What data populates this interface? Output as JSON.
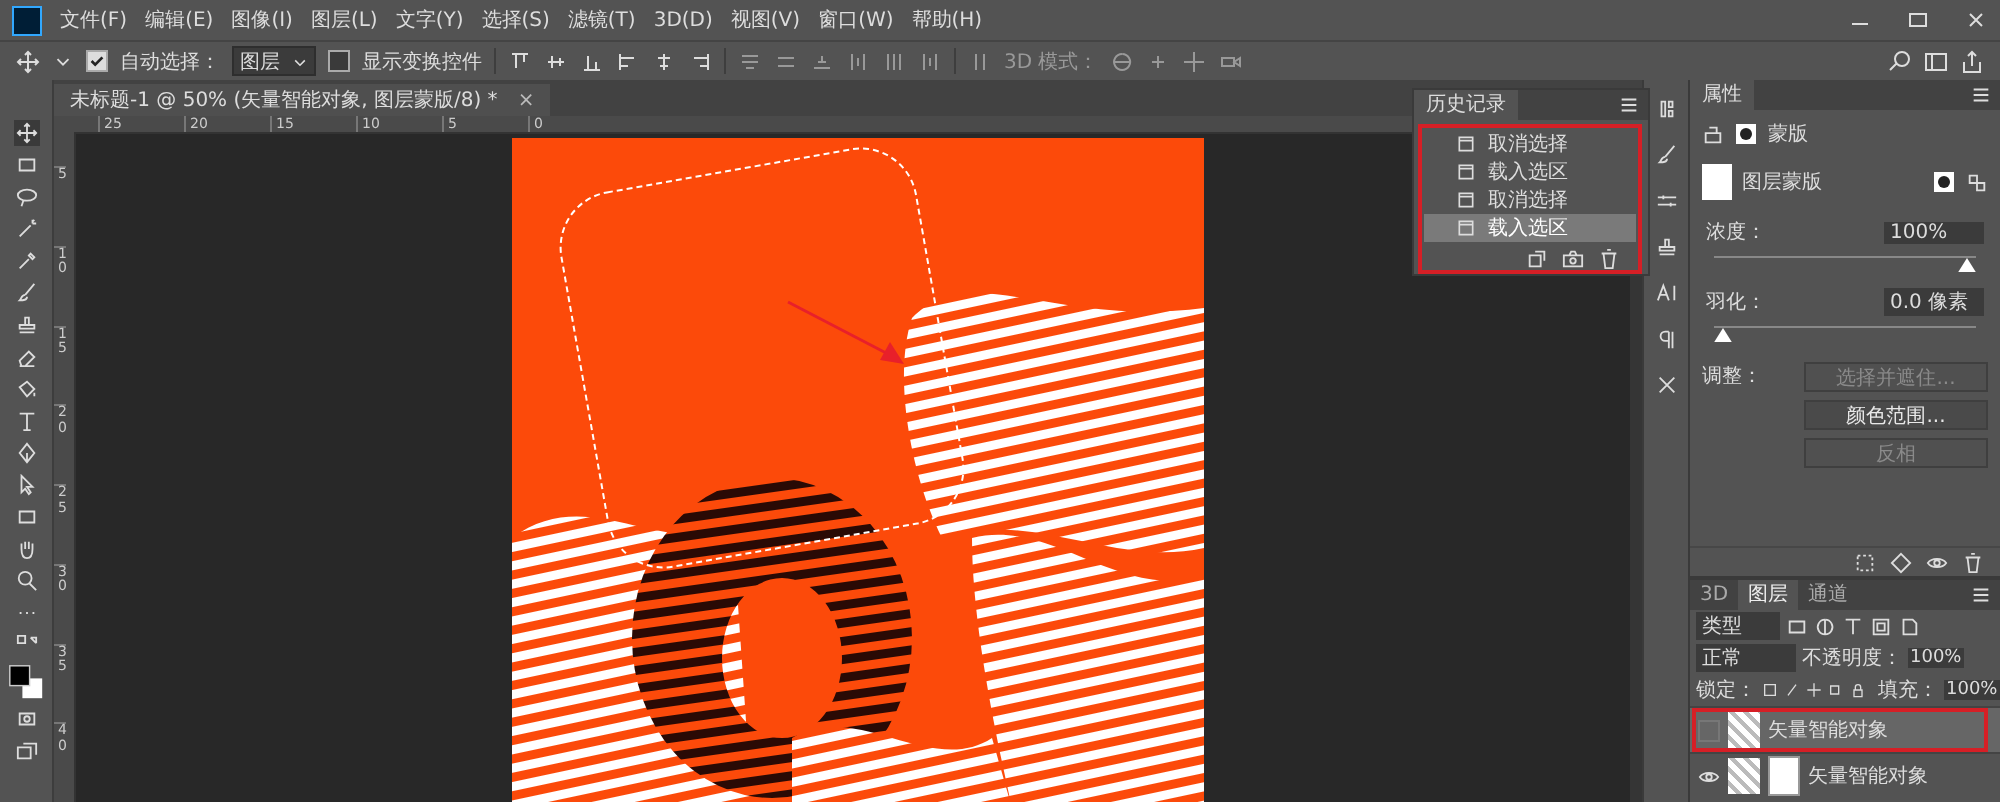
{
  "menu_bar": {
    "items": [
      "文件(F)",
      "编辑(E)",
      "图像(I)",
      "图层(L)",
      "文字(Y)",
      "选择(S)",
      "滤镜(T)",
      "3D(D)",
      "视图(V)",
      "窗口(W)",
      "帮助(H)"
    ]
  },
  "options_bar": {
    "auto_select": {
      "label": "自动选择：",
      "checked": true
    },
    "auto_select_target": "图层",
    "show_transform_controls": {
      "label": "显示变换控件",
      "checked": false
    },
    "mode_3d_label": "3D 模式："
  },
  "document_tab": {
    "title": "未标题-1 @ 50% (矢量智能对象, 图层蒙版/8) *",
    "close": "×"
  },
  "rulers": {
    "top_labels": [
      "25",
      "20",
      "15",
      "10",
      "5",
      "0"
    ],
    "left_labels": [
      "5",
      "10",
      "15",
      "20",
      "25",
      "30",
      "35",
      "40"
    ]
  },
  "history_panel": {
    "title": "历史记录",
    "items": [
      {
        "label": "取消选择",
        "selected": false
      },
      {
        "label": "载入选区",
        "selected": false
      },
      {
        "label": "取消选择",
        "selected": false
      },
      {
        "label": "载入选区",
        "selected": true
      }
    ]
  },
  "properties_panel": {
    "title": "属性",
    "section": "蒙版",
    "mask_type": "图层蒙版",
    "density": {
      "label": "浓度：",
      "value": "100%",
      "level": 1
    },
    "feather": {
      "label": "羽化：",
      "value": "0.0 像素",
      "level": 0
    },
    "adjust_label": "调整：",
    "buttons": [
      {
        "label": "选择并遮住...",
        "disabled": true
      },
      {
        "label": "颜色范围...",
        "disabled": false
      },
      {
        "label": "反相",
        "disabled": true
      }
    ]
  },
  "layers_panel": {
    "tabs": [
      {
        "label": "3D",
        "selected": false
      },
      {
        "label": "图层",
        "selected": true
      },
      {
        "label": "通道",
        "selected": false
      }
    ],
    "filter": "类型",
    "blend_mode": "正常",
    "opacity_label": "不透明度：",
    "opacity": "100%",
    "lock_label": "锁定：",
    "fill_label": "填充：",
    "fill": "100%",
    "layers": [
      {
        "name": "矢量智能对象",
        "selected": true,
        "visible": false,
        "has_mask": false
      },
      {
        "name": "矢量智能对象",
        "selected": false,
        "visible": true,
        "has_mask": true
      }
    ]
  }
}
